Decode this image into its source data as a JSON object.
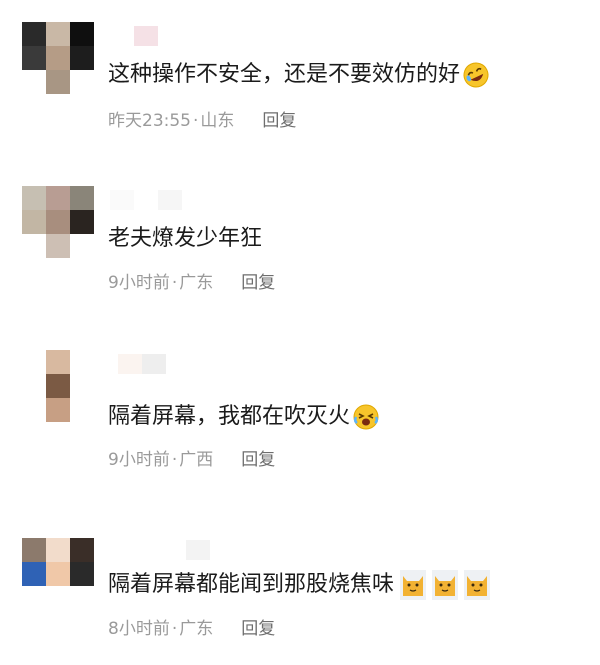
{
  "comments": [
    {
      "text": "这种操作不安全，还是不要效仿的好",
      "time": "昨天23:55",
      "separator": "·",
      "location": "山东",
      "reply_label": "回复",
      "emoji": "rofl-emoji"
    },
    {
      "text": "老夫燎发少年狂",
      "time": "9小时前",
      "separator": "·",
      "location": "广东",
      "reply_label": "回复"
    },
    {
      "text": "隔着屏幕，我都在吹灭火",
      "time": "9小时前",
      "separator": "·",
      "location": "广西",
      "reply_label": "回复",
      "emoji": "crying-laughing-emoji"
    },
    {
      "text": "隔着屏幕都能闻到那股烧焦味",
      "time": "8小时前",
      "separator": "·",
      "location": "广东",
      "reply_label": "回复",
      "emoji": "cat-emoji-x3"
    }
  ],
  "colors": {
    "text": "#1b1b1b",
    "meta": "#9a9a9a",
    "reply": "#6e6e6e",
    "emoji_yellow": "#f7c52b"
  }
}
